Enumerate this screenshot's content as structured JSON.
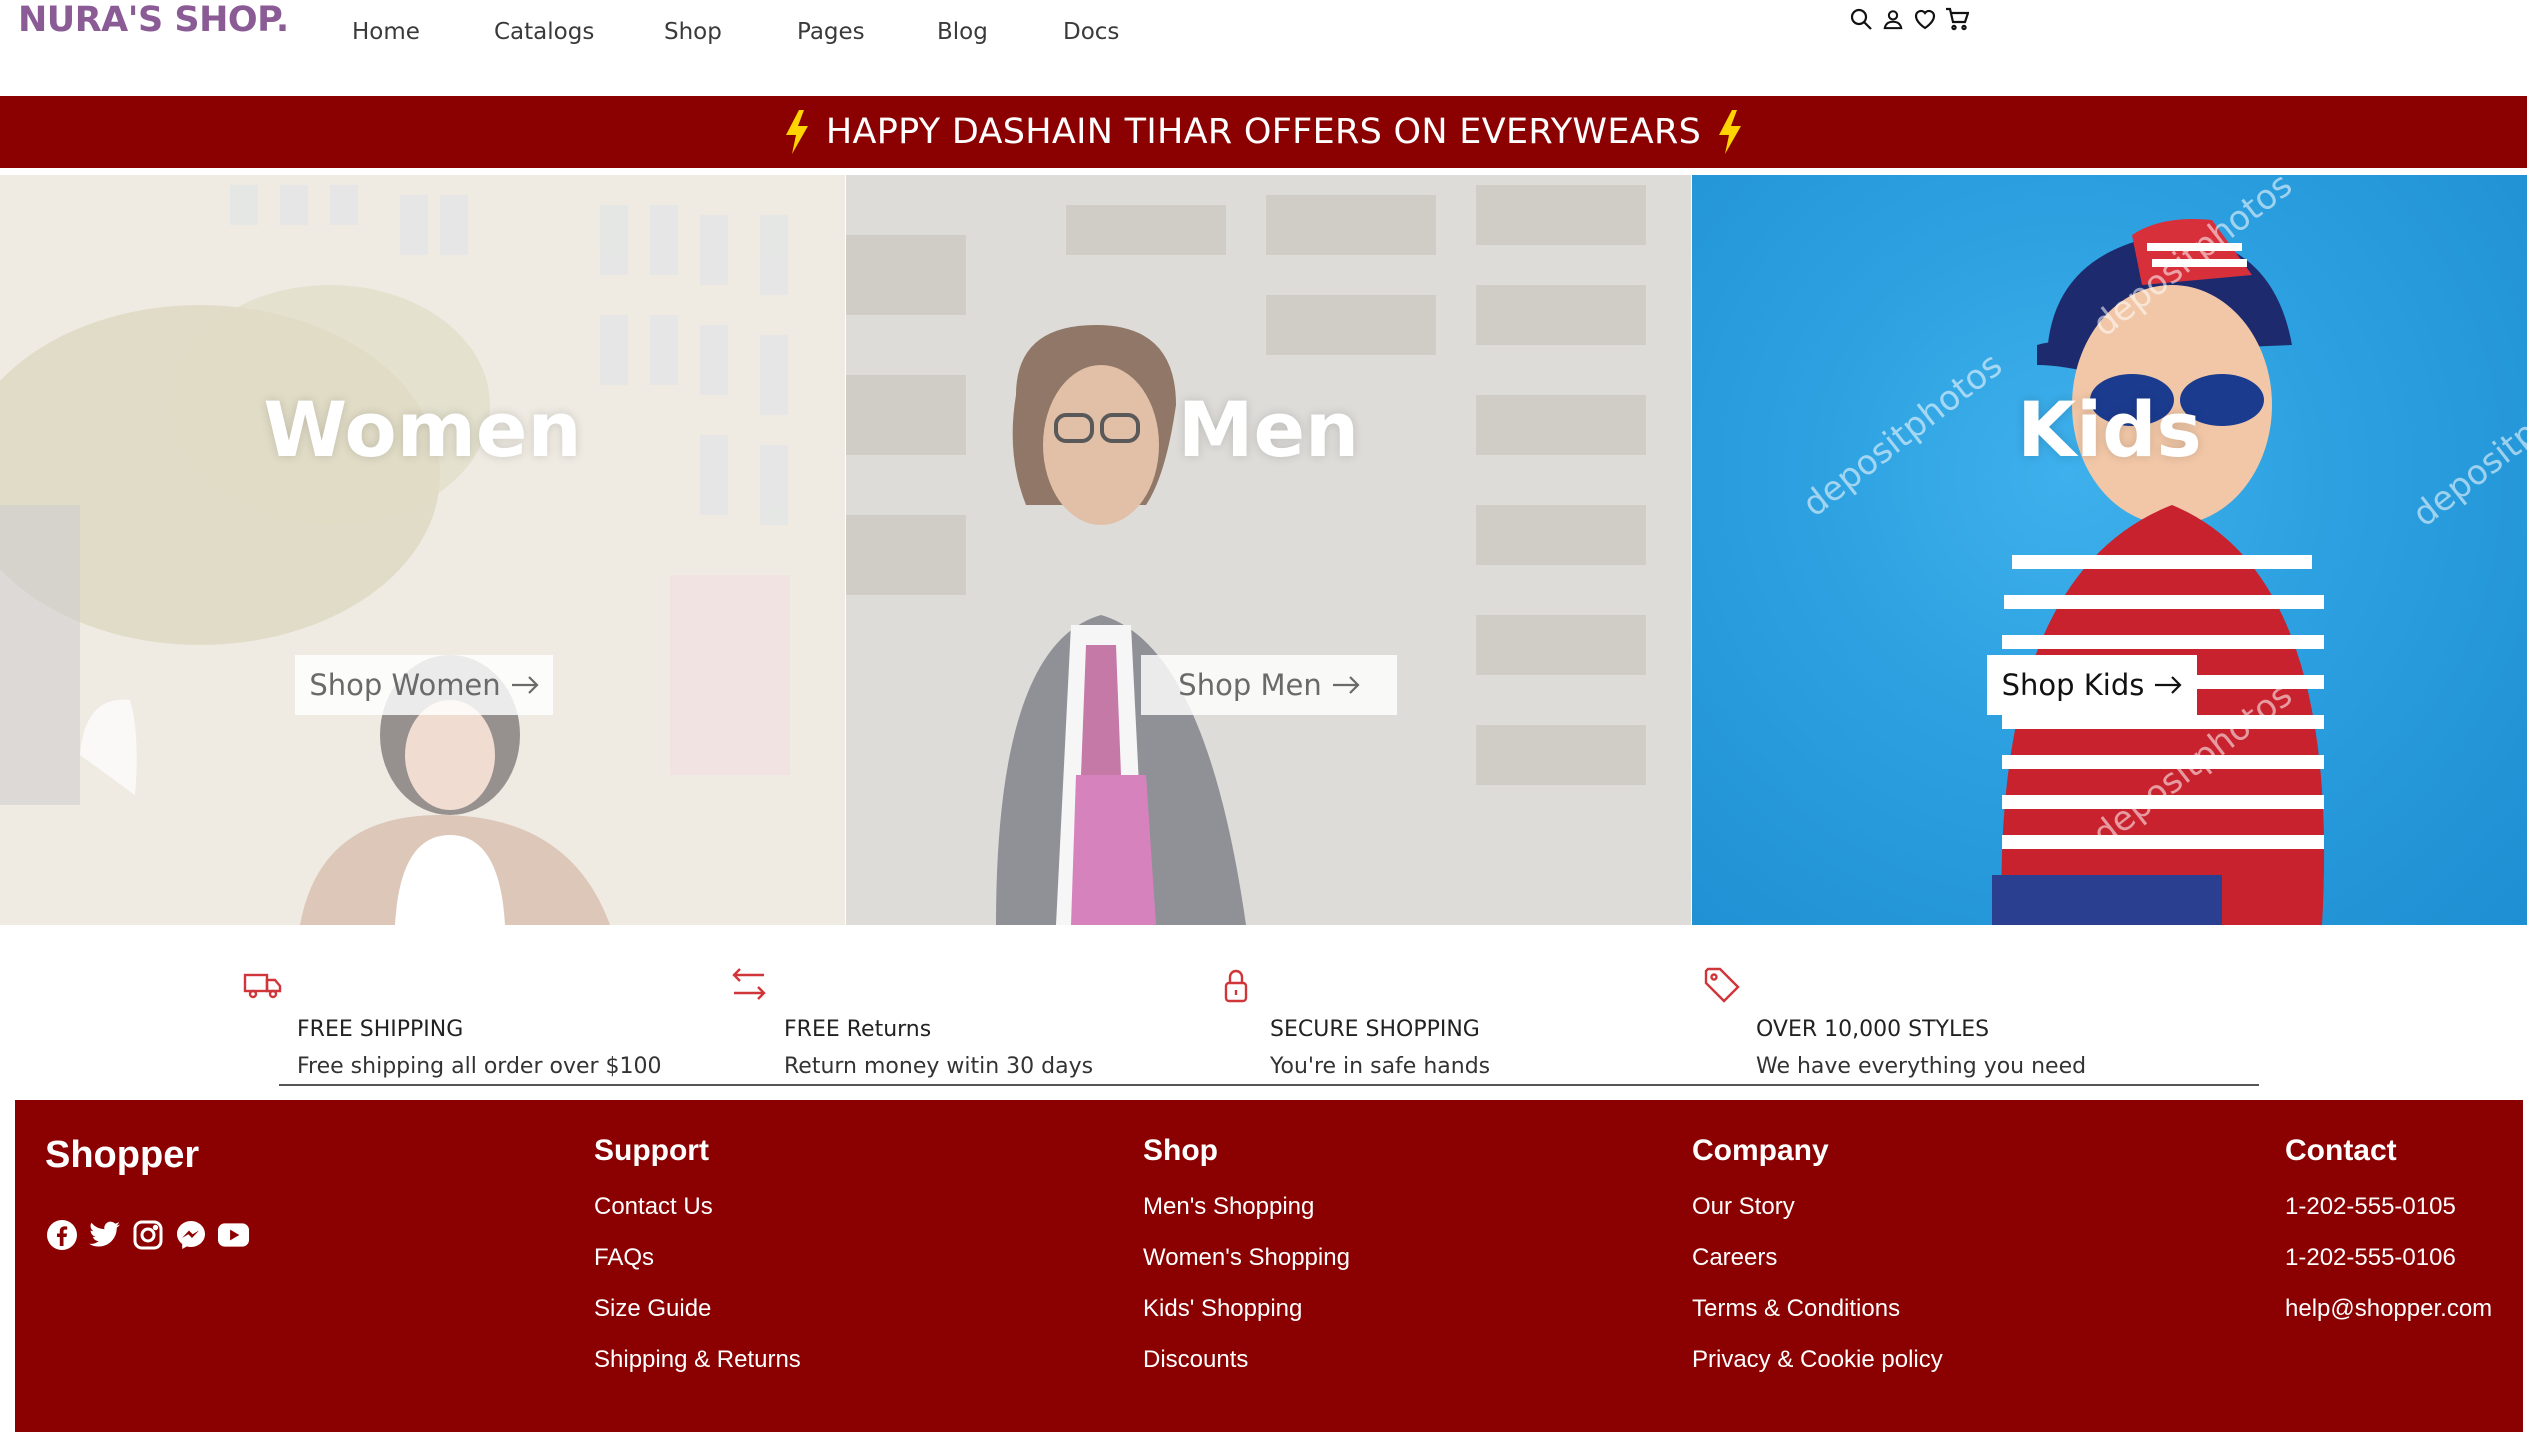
{
  "header": {
    "logo": "NURA'S SHOP.",
    "nav": [
      "Home",
      "Catalogs",
      "Shop",
      "Pages",
      "Blog",
      "Docs"
    ],
    "icons": [
      "search-icon",
      "user-icon",
      "heart-icon",
      "cart-icon"
    ]
  },
  "promo": {
    "text": "HAPPY DASHAIN TIHAR OFFERS ON EVERYWEARS",
    "color": "#8b0000",
    "icon": "lightning-bolt-icon"
  },
  "categories": [
    {
      "title": "Women",
      "button": "Shop Women"
    },
    {
      "title": "Men",
      "button": "Shop Men"
    },
    {
      "title": "Kids",
      "button": "Shop Kids",
      "watermark": "depositphotos"
    }
  ],
  "features": [
    {
      "icon": "truck-icon",
      "title": "FREE SHIPPING",
      "desc": "Free shipping all order over $100"
    },
    {
      "icon": "exchange-icon",
      "title": "FREE Returns",
      "desc": "Return money witin 30 days"
    },
    {
      "icon": "lock-icon",
      "title": "SECURE SHOPPING",
      "desc": "You're in safe hands"
    },
    {
      "icon": "tag-icon",
      "title": "OVER 10,000 STYLES",
      "desc": "We have everything you need"
    }
  ],
  "footer": {
    "brand": "Shopper",
    "socials": [
      "facebook-icon",
      "twitter-icon",
      "instagram-icon",
      "messenger-icon",
      "youtube-icon"
    ],
    "columns": [
      {
        "title": "Support",
        "links": [
          "Contact Us",
          "FAQs",
          "Size Guide",
          "Shipping & Returns"
        ]
      },
      {
        "title": "Shop",
        "links": [
          "Men's Shopping",
          "Women's Shopping",
          "Kids' Shopping",
          "Discounts"
        ]
      },
      {
        "title": "Company",
        "links": [
          "Our Story",
          "Careers",
          "Terms & Conditions",
          "Privacy & Cookie policy"
        ]
      },
      {
        "title": "Contact",
        "links": [
          "1-202-555-0105",
          "1-202-555-0106",
          "help@shopper.com"
        ]
      }
    ]
  },
  "colors": {
    "brand_red": "#8b0000",
    "logo_purple": "#8a5b95",
    "feature_icon": "#d0353a",
    "bolt_yellow": "#ffd400"
  }
}
